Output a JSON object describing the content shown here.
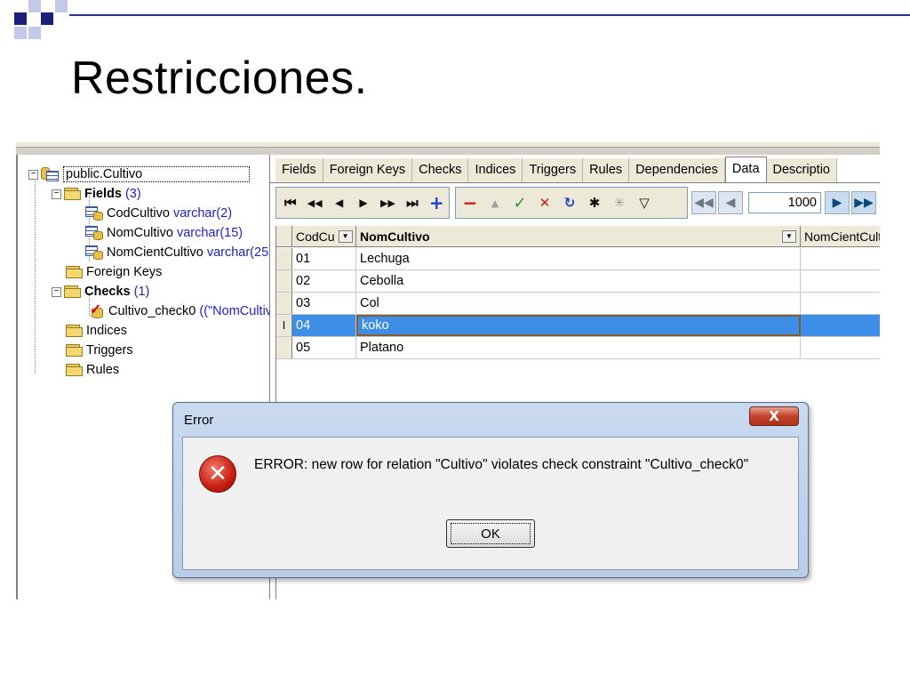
{
  "slide": {
    "title": "Restricciones.",
    "colors": {
      "dark_square": "#1a1f7a",
      "light_square": "#c5c8e8",
      "accent_line": "#2a2f9a"
    }
  },
  "tree": {
    "root": "public.Cultivo",
    "fields_label": "Fields",
    "fields_count": "(3)",
    "fields": [
      {
        "name": "CodCultivo",
        "type": "varchar(2)"
      },
      {
        "name": "NomCultivo",
        "type": "varchar(15)"
      },
      {
        "name": "NomCientCultivo",
        "type": "varchar(25"
      }
    ],
    "foreign_keys": "Foreign Keys",
    "checks_label": "Checks",
    "checks_count": "(1)",
    "check_item": {
      "name": "Cultivo_check0",
      "def": "((\"NomCultiv"
    },
    "indices": "Indices",
    "triggers": "Triggers",
    "rules": "Rules"
  },
  "tabs": [
    "Fields",
    "Foreign Keys",
    "Checks",
    "Indices",
    "Triggers",
    "Rules",
    "Dependencies",
    "Data",
    "Descriptio"
  ],
  "active_tab": "Data",
  "toolbar": {
    "icons": [
      "first-icon",
      "prior-page-icon",
      "prior-icon",
      "next-icon",
      "next-page-icon",
      "last-icon",
      "insert-icon",
      "delete-icon",
      "edit-icon",
      "post-icon",
      "cancel-icon",
      "refresh-icon",
      "asterisk-icon",
      "clear-icon",
      "filter-icon"
    ],
    "glyphs": [
      "⏮",
      "◀◀",
      "◀",
      "▶",
      "▶▶",
      "⏭",
      "+",
      "−",
      "▲",
      "✓",
      "✕",
      "↻",
      "✱",
      "✳",
      "▽"
    ],
    "row_limit": "1000"
  },
  "grid": {
    "columns": [
      "CodCu",
      "NomCultivo",
      "NomCientCult"
    ],
    "rows": [
      {
        "cod": "01",
        "nom": "Lechuga",
        "cient": ""
      },
      {
        "cod": "02",
        "nom": "Cebolla",
        "cient": ""
      },
      {
        "cod": "03",
        "nom": "Col",
        "cient": ""
      },
      {
        "cod": "04",
        "nom": "koko",
        "cient": ""
      },
      {
        "cod": "05",
        "nom": "Platano",
        "cient": ""
      }
    ],
    "selected_row_indicator": "I"
  },
  "dialog": {
    "title": "Error",
    "close_glyph": "X",
    "message": "ERROR:  new row for relation \"Cultivo\" violates check constraint \"Cultivo_check0\"",
    "ok_label": "OK"
  }
}
